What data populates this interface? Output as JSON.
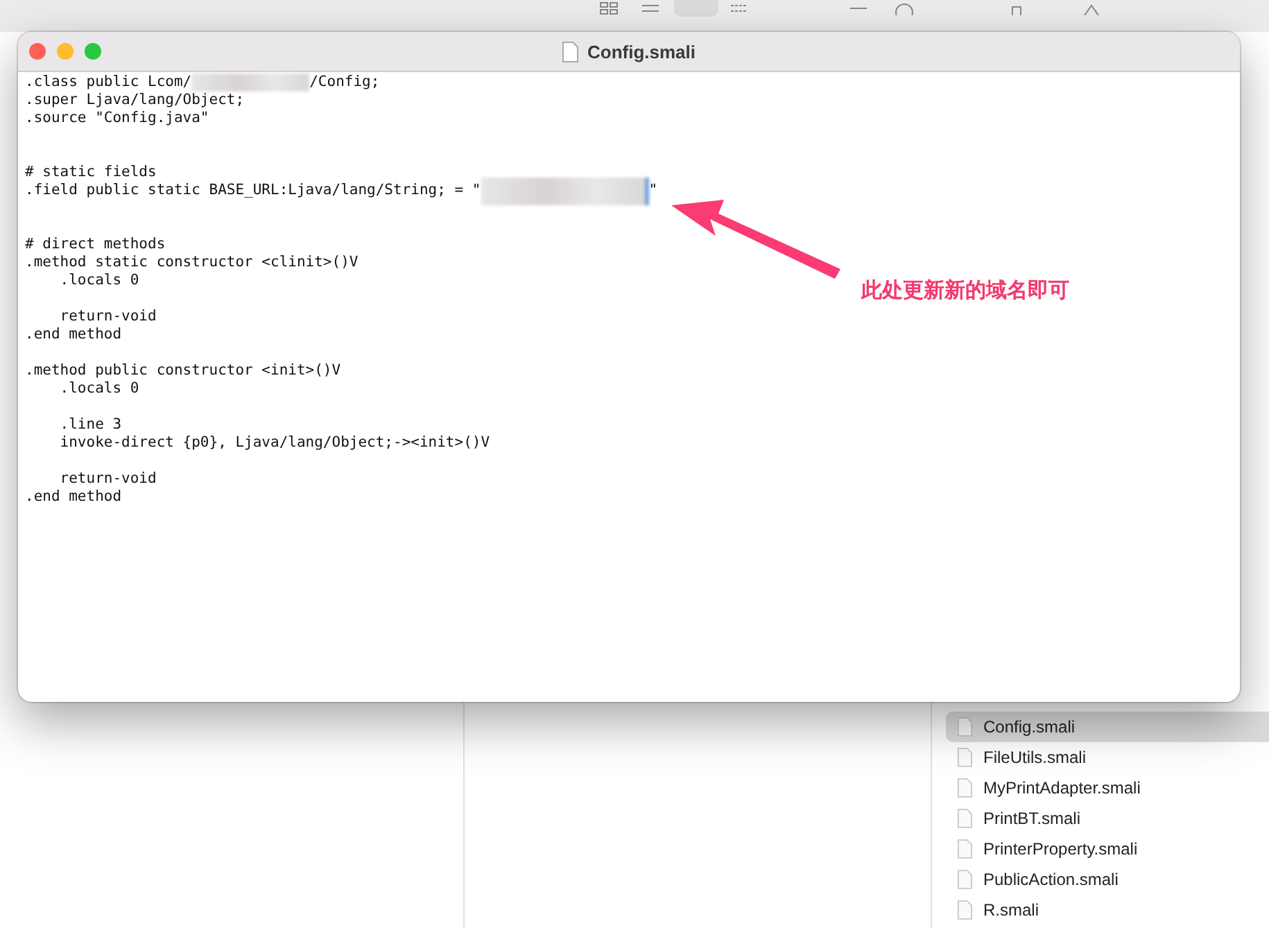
{
  "editor": {
    "title": "Config.smali",
    "lines": [
      {
        "kind": "code",
        "parts": [
          {
            "kind": "text",
            "text": ".class public Lcom/"
          },
          {
            "kind": "redacted"
          },
          {
            "kind": "text",
            "text": "/Config;"
          }
        ]
      },
      {
        "kind": "code",
        "parts": [
          {
            "kind": "text",
            "text": ".super Ljava/lang/Object;"
          }
        ]
      },
      {
        "kind": "code",
        "parts": [
          {
            "kind": "text",
            "text": ".source \"Config.java\""
          }
        ]
      },
      {
        "kind": "blank"
      },
      {
        "kind": "blank"
      },
      {
        "kind": "code",
        "parts": [
          {
            "kind": "text",
            "text": "# static fields"
          }
        ]
      },
      {
        "kind": "code",
        "parts": [
          {
            "kind": "text",
            "text": ".field public static BASE_URL:Ljava/lang/String; = \""
          },
          {
            "kind": "redacted"
          },
          {
            "kind": "text",
            "text": "\""
          }
        ]
      },
      {
        "kind": "blank"
      },
      {
        "kind": "blank"
      },
      {
        "kind": "code",
        "parts": [
          {
            "kind": "text",
            "text": "# direct methods"
          }
        ]
      },
      {
        "kind": "code",
        "parts": [
          {
            "kind": "text",
            "text": ".method static constructor <clinit>()V"
          }
        ]
      },
      {
        "kind": "code",
        "parts": [
          {
            "kind": "text",
            "text": "    .locals 0"
          }
        ]
      },
      {
        "kind": "blank"
      },
      {
        "kind": "code",
        "parts": [
          {
            "kind": "text",
            "text": "    return-void"
          }
        ]
      },
      {
        "kind": "code",
        "parts": [
          {
            "kind": "text",
            "text": ".end method"
          }
        ]
      },
      {
        "kind": "blank"
      },
      {
        "kind": "code",
        "parts": [
          {
            "kind": "text",
            "text": ".method public constructor <init>()V"
          }
        ]
      },
      {
        "kind": "code",
        "parts": [
          {
            "kind": "text",
            "text": "    .locals 0"
          }
        ]
      },
      {
        "kind": "blank"
      },
      {
        "kind": "code",
        "parts": [
          {
            "kind": "text",
            "text": "    .line 3"
          }
        ]
      },
      {
        "kind": "code",
        "parts": [
          {
            "kind": "text",
            "text": "    invoke-direct {p0}, Ljava/lang/Object;-><init>()V"
          }
        ]
      },
      {
        "kind": "blank"
      },
      {
        "kind": "code",
        "parts": [
          {
            "kind": "text",
            "text": "    return-void"
          }
        ]
      },
      {
        "kind": "code",
        "parts": [
          {
            "kind": "text",
            "text": ".end method"
          }
        ]
      }
    ]
  },
  "annotation": {
    "text": "此处更新新的域名即可"
  },
  "finder": {
    "files": [
      {
        "name": "Config.smali",
        "selected": true
      },
      {
        "name": "FileUtils.smali",
        "selected": false
      },
      {
        "name": "MyPrintAdapter.smali",
        "selected": false
      },
      {
        "name": "PrintBT.smali",
        "selected": false
      },
      {
        "name": "PrinterProperty.smali",
        "selected": false
      },
      {
        "name": "PublicAction.smali",
        "selected": false
      },
      {
        "name": "R.smali",
        "selected": false
      }
    ]
  }
}
